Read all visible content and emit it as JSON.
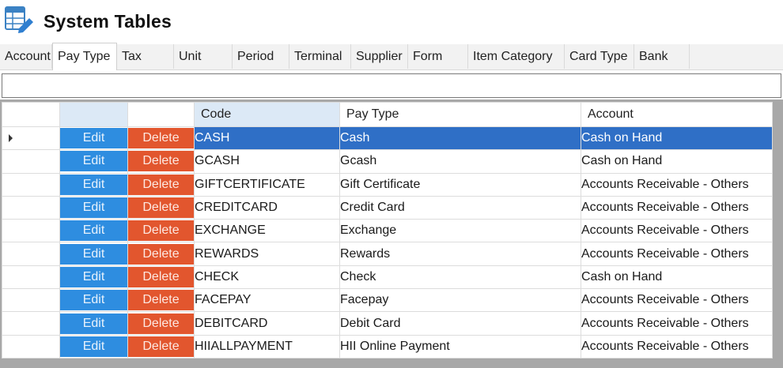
{
  "app": {
    "title": "System Tables"
  },
  "tabs": [
    {
      "label": "Account",
      "active": false
    },
    {
      "label": "Pay Type",
      "active": true
    },
    {
      "label": "Tax",
      "active": false
    },
    {
      "label": "Unit",
      "active": false
    },
    {
      "label": "Period",
      "active": false
    },
    {
      "label": "Terminal",
      "active": false
    },
    {
      "label": "Supplier",
      "active": false
    },
    {
      "label": "Form",
      "active": false
    },
    {
      "label": "Item Category",
      "active": false
    },
    {
      "label": "Card Type",
      "active": false
    },
    {
      "label": "Bank",
      "active": false
    }
  ],
  "search": {
    "value": ""
  },
  "grid": {
    "columns": {
      "code": "Code",
      "pay_type": "Pay Type",
      "account": "Account"
    },
    "edit_label": "Edit",
    "delete_label": "Delete",
    "selected_row": 0,
    "rows": [
      {
        "code": "CASH",
        "pay_type": "Cash",
        "account": "Cash on Hand"
      },
      {
        "code": "GCASH",
        "pay_type": "Gcash",
        "account": "Cash on Hand"
      },
      {
        "code": "GIFTCERTIFICATE",
        "pay_type": "Gift Certificate",
        "account": "Accounts Receivable - Others"
      },
      {
        "code": "CREDITCARD",
        "pay_type": "Credit Card",
        "account": "Accounts Receivable - Others"
      },
      {
        "code": "EXCHANGE",
        "pay_type": "Exchange",
        "account": "Accounts Receivable - Others"
      },
      {
        "code": "REWARDS",
        "pay_type": "Rewards",
        "account": "Accounts Receivable - Others"
      },
      {
        "code": "CHECK",
        "pay_type": "Check",
        "account": "Cash on Hand"
      },
      {
        "code": "FACEPAY",
        "pay_type": "Facepay",
        "account": "Accounts Receivable - Others"
      },
      {
        "code": "DEBITCARD",
        "pay_type": "Debit Card",
        "account": "Accounts Receivable - Others"
      },
      {
        "code": "HIIALLPAYMENT",
        "pay_type": "HII Online Payment",
        "account": "Accounts Receivable - Others"
      }
    ]
  },
  "colors": {
    "edit": "#2e8de0",
    "delete": "#e2562e",
    "selection": "#2f6fc6"
  }
}
